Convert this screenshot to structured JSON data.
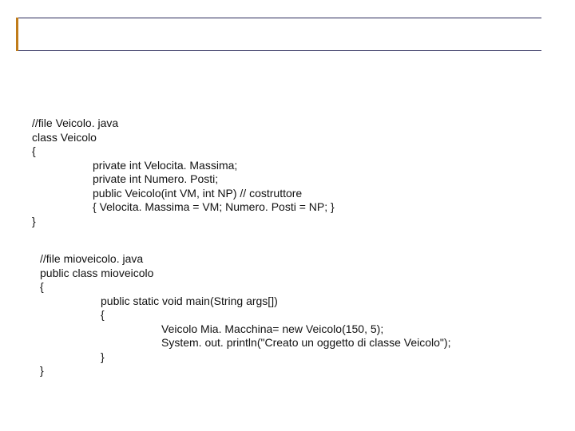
{
  "code1": {
    "l1": "//file Veicolo. java",
    "l2": "class Veicolo",
    "l3": "{",
    "l4": "private int Velocita. Massima;",
    "l5": "private int Numero. Posti;",
    "l6": "public Veicolo(int VM, int NP) // costruttore",
    "l7": "{ Velocita. Massima = VM; Numero. Posti = NP; }",
    "l8": "}"
  },
  "code2": {
    "l1": "//file mioveicolo. java",
    "l2": "public class mioveicolo",
    "l3": "{",
    "l4": "public static void main(String args[])",
    "l5": "{",
    "l6": "Veicolo Mia. Macchina= new Veicolo(150, 5);",
    "l7": "System. out. println(\"Creato un oggetto di classe Veicolo\");",
    "l8": "}",
    "l9": "}"
  }
}
